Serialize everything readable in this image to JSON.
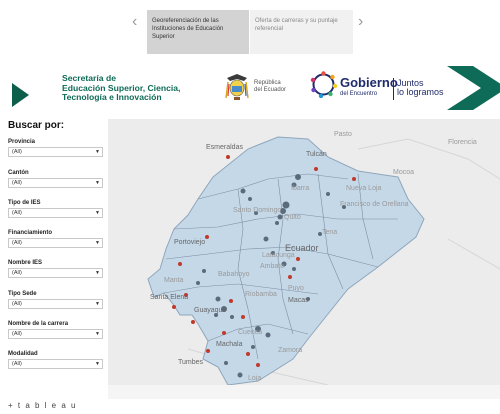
{
  "story": {
    "points": [
      {
        "label": "Georeferenciación de las Instituciones de Educación Superior",
        "active": true
      },
      {
        "label": "Oferta de carreras y su puntaje referencial",
        "active": false
      }
    ],
    "prev_icon": "chevron-left-icon",
    "next_icon": "chevron-right-icon"
  },
  "header": {
    "senescyt_lines": [
      "Secretaría de",
      "Educación Superior, Ciencia,",
      "Tecnología e Innovación"
    ],
    "republica_lines": [
      "República",
      "del Ecuador"
    ],
    "gobierno_title": "Gobierno",
    "gobierno_sub": "del Encuentro",
    "juntos_lines": [
      "Juntos",
      "lo logramos"
    ],
    "brand_color": "#0e6b57",
    "gobierno_color": "#1f2b6b"
  },
  "filters": {
    "heading": "Buscar por:",
    "items": [
      {
        "label": "Provincia",
        "value": "(All)"
      },
      {
        "label": "Cantón",
        "value": "(All)"
      },
      {
        "label": "Tipo de IES",
        "value": "(All)"
      },
      {
        "label": "Financiamiento",
        "value": "(All)"
      },
      {
        "label": "Nombre IES",
        "value": "(All)"
      },
      {
        "label": "Tipo Sede",
        "value": "(All)"
      },
      {
        "label": "Nombre de la carrera",
        "value": "(All)"
      },
      {
        "label": "Modalidad",
        "value": "(All)"
      }
    ]
  },
  "map": {
    "labels": {
      "esmeraldas": "Esmeraldas",
      "tulcan": "Tulcán",
      "pasto": "Pasto",
      "ecuador": "Ecuador",
      "portoviejo": "Portoviejo",
      "manta": "Manta",
      "santa_elena": "Santa Elena",
      "babahoyo": "Babahoyo",
      "guayaquil": "Guayaquil",
      "riobamba": "Riobamba",
      "macas": "Macas",
      "cuenca": "Cuenca",
      "machala": "Machala",
      "tumbes": "Tumbes",
      "loja": "Loja",
      "nueva_loja": "Nueva Loja",
      "tena": "Tena",
      "puyo": "Puyo",
      "orellana": "Francisco de Orellana",
      "mocoa": "Mocoa",
      "quito": "Quito",
      "latacunga": "Latacunga",
      "ambato": "Ambato",
      "santo_domingo": "Santo Domingo",
      "ibarra": "Ibarra",
      "florencia": "Florencia",
      "zamora": "Zamora"
    },
    "land_color": "#c5d8e8",
    "marker_red": "#c0392b",
    "marker_gray": "#5b6b7b"
  },
  "footer": {
    "brand": "+ t a b l e a u"
  }
}
